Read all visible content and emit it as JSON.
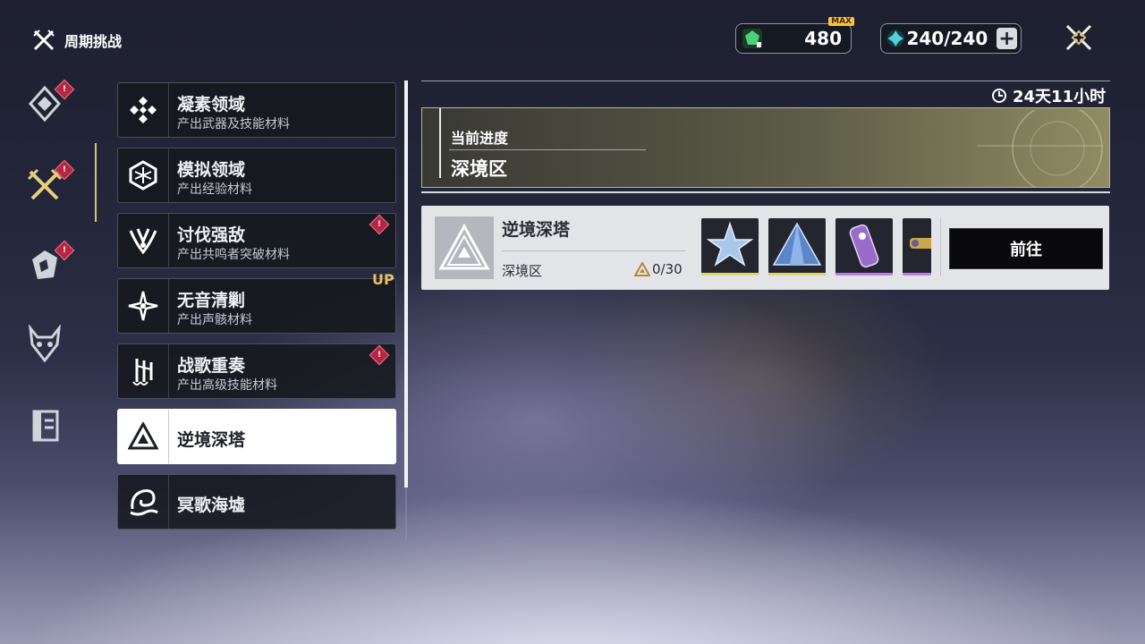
{
  "header": {
    "title": "周期挑战",
    "close_icon": "close-icon"
  },
  "resources": [
    {
      "icon": "green-crystal-icon",
      "value": "480",
      "badge": "MAX"
    },
    {
      "icon": "teal-crystal-icon",
      "value": "240/240",
      "add_icon": "plus-icon"
    }
  ],
  "left_rail": [
    {
      "icon": "diamond-emblem-icon",
      "alert": "!"
    },
    {
      "icon": "crossed-swords-icon",
      "alert": "!",
      "selected": true
    },
    {
      "icon": "shield-emblem-icon",
      "alert": "!"
    },
    {
      "icon": "demon-mask-icon"
    },
    {
      "icon": "book-emblem-icon"
    }
  ],
  "challenges": [
    {
      "title": "凝素领域",
      "subtitle": "产出武器及技能材料",
      "icon": "diamond-cluster-icon",
      "alert": false
    },
    {
      "title": "模拟领域",
      "subtitle": "产出经验材料",
      "icon": "sim-cube-icon",
      "alert": false
    },
    {
      "title": "讨伐强敌",
      "subtitle": "产出共鸣者突破材料",
      "icon": "claw-emblem-icon",
      "alert": true
    },
    {
      "title": "无音清剿",
      "subtitle": "产出声骸材料",
      "icon": "star-burst-icon",
      "alert": false
    },
    {
      "title": "战歌重奏",
      "subtitle": "产出高级技能材料",
      "icon": "music-rune-icon",
      "alert": true
    },
    {
      "title": "逆境深塔",
      "subtitle": "",
      "icon": "triangle-tower-icon",
      "selected": true
    },
    {
      "title": "冥歌海墟",
      "subtitle": "",
      "icon": "sea-beast-icon"
    }
  ],
  "up_label": "UP",
  "alert_glyph": "!",
  "timer": {
    "icon": "clock-icon",
    "text": "24天11小时"
  },
  "progress": {
    "label": "当前进度",
    "area": "深境区"
  },
  "tower": {
    "title": "逆境深塔",
    "area": "深境区",
    "count": "0/30",
    "count_icon": "triangle-stat-icon",
    "rewards": [
      {
        "icon": "star-crystal-icon",
        "rarity_color": "#e6d36a"
      },
      {
        "icon": "blue-pyramid-icon",
        "rarity_color": "#e6d36a"
      },
      {
        "icon": "purple-vial-icon",
        "rarity_color": "#c07be6"
      },
      {
        "icon": "gold-rod-icon",
        "rarity_color": "#c07be6"
      }
    ],
    "go_label": "前往"
  }
}
